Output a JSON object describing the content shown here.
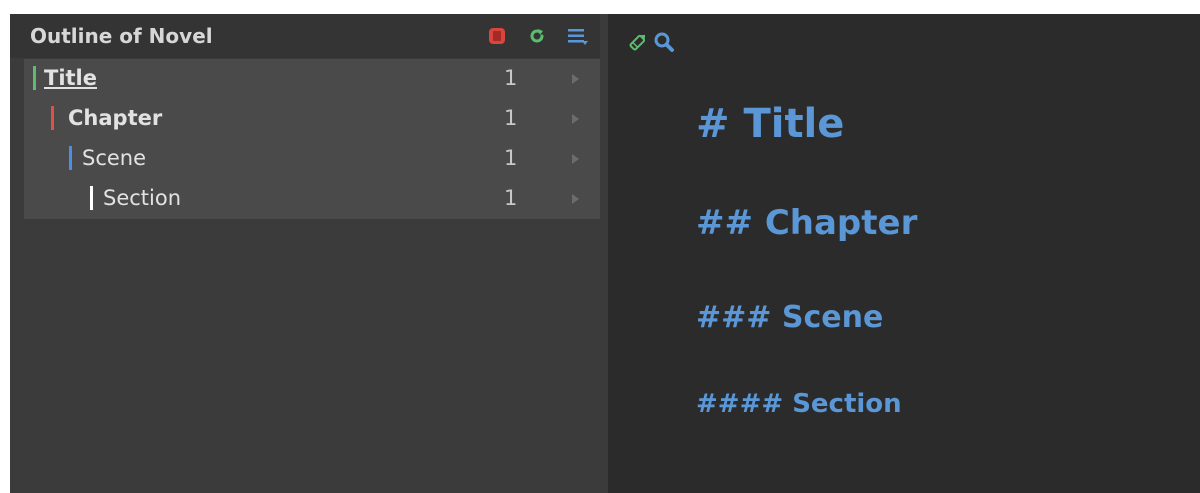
{
  "outline": {
    "title": "Outline of Novel",
    "icons": [
      "stop-icon",
      "refresh-icon",
      "menu-icon"
    ],
    "items": [
      {
        "label": "Title",
        "count": "1",
        "level": 1,
        "color": "#5bbd6e"
      },
      {
        "label": "Chapter",
        "count": "1",
        "level": 2,
        "color": "#e0504a"
      },
      {
        "label": "Scene",
        "count": "1",
        "level": 3,
        "color": "#4a90e2"
      },
      {
        "label": "Section",
        "count": "1",
        "level": 4,
        "color": "#ffffff"
      }
    ]
  },
  "editor": {
    "toolbar_icons": [
      "pencil-icon",
      "search-icon"
    ],
    "headings": [
      "# Title",
      "## Chapter",
      "### Scene",
      "#### Section"
    ]
  },
  "colors": {
    "heading": "#5b97d6",
    "panel": "#3b3b3b",
    "editor_bg": "#2b2b2b",
    "stop": "#d9443d",
    "refresh": "#5bbd6e",
    "menu": "#5b97d6"
  }
}
